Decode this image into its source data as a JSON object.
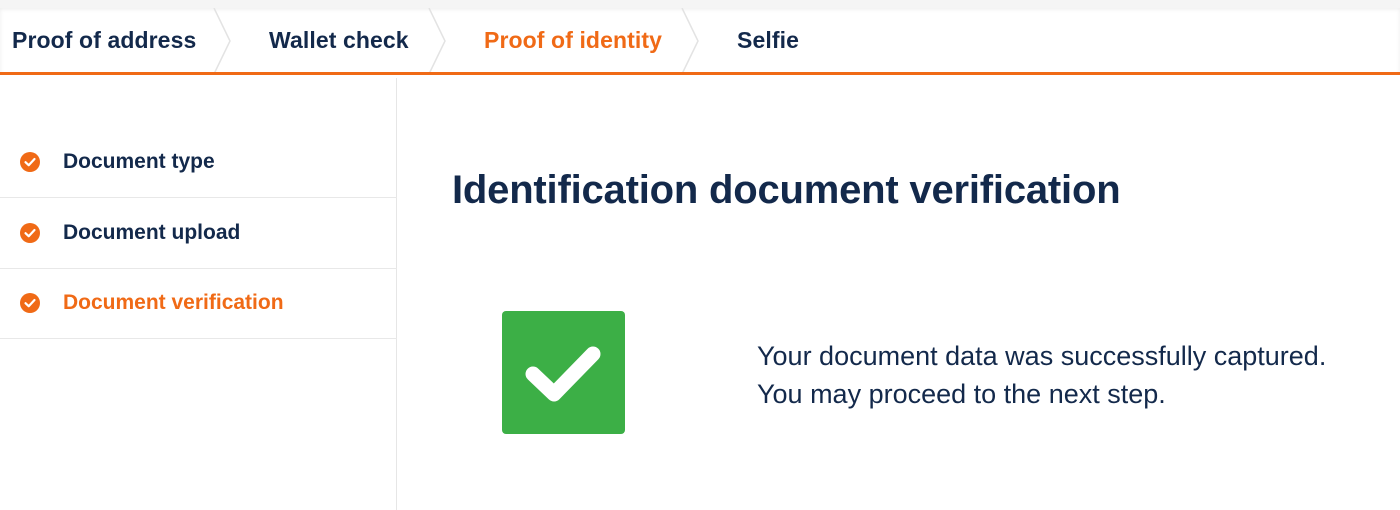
{
  "steps": {
    "items": [
      {
        "label": "Proof of address",
        "state": "default"
      },
      {
        "label": "Wallet check",
        "state": "default"
      },
      {
        "label": "Proof of identity",
        "state": "active"
      },
      {
        "label": "Selfie",
        "state": "default"
      }
    ]
  },
  "sidebar": {
    "items": [
      {
        "label": "Document type",
        "icon": "check-circle-icon",
        "state": "done"
      },
      {
        "label": "Document upload",
        "icon": "check-circle-icon",
        "state": "done"
      },
      {
        "label": "Document verification",
        "icon": "check-circle-icon",
        "state": "active"
      }
    ]
  },
  "main": {
    "title": "Identification document verification",
    "status_icon": "checkmark-icon",
    "message_line1": "Your document data was successfully captured.",
    "message_line2": "You may proceed to the next step."
  },
  "colors": {
    "accent": "#f06a16",
    "text": "#13294b",
    "success": "#3caf46"
  }
}
